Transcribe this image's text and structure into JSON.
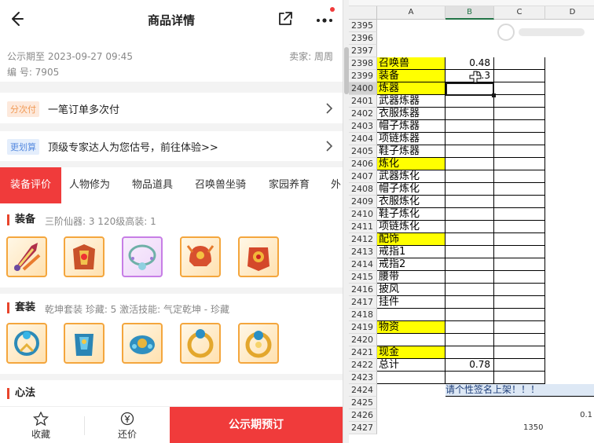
{
  "app": {
    "title": "商品详情",
    "announce_time": "公示期至 2023-09-27 09:45",
    "serial_label": "编 号: 7905",
    "seller_label": "卖家: 周周",
    "promos": [
      {
        "tag": "分次付",
        "text": "一笔订单多次付"
      },
      {
        "tag": "更划算",
        "text": "顶级专家达人为您估号，前往体验>>"
      }
    ],
    "tabs": [
      "装备评价",
      "人物修为",
      "物品道具",
      "召唤兽坐骑",
      "家园养育",
      "外"
    ],
    "equip": {
      "title": "装备",
      "sub": "三阶仙器: 3   120级高装: 1"
    },
    "suit": {
      "title": "套装",
      "sub": "乾坤套装  珍藏: 5  激活技能: 气定乾坤 - 珍藏"
    },
    "xinfa": {
      "title": "心法"
    },
    "bottom": {
      "fav": "收藏",
      "bargain": "还价",
      "buy": "公示期预订"
    },
    "colors": {
      "accent": "#f03b3b",
      "tag_orange": "#f19a55",
      "tag_blue": "#5b8de0"
    }
  },
  "sheet": {
    "columns": [
      "A",
      "B",
      "C",
      "D"
    ],
    "selected_column": "B",
    "selected_row": "2400",
    "rows": [
      {
        "n": "2395",
        "a": "",
        "b": "",
        "ay": false,
        "by": false
      },
      {
        "n": "2396",
        "a": "",
        "b": "",
        "ay": false,
        "by": false
      },
      {
        "n": "2397",
        "a": "",
        "b": "",
        "ay": false,
        "by": false
      },
      {
        "n": "2398",
        "a": "召唤兽",
        "b": "0.48",
        "ay": true,
        "by": true
      },
      {
        "n": "2399",
        "a": "装备",
        "b": "0.3",
        "ay": true,
        "by": true
      },
      {
        "n": "2400",
        "a": "炼器",
        "b": "",
        "ay": true,
        "by": false
      },
      {
        "n": "2401",
        "a": "武器炼器",
        "b": "",
        "ay": false,
        "by": false
      },
      {
        "n": "2402",
        "a": "衣服炼器",
        "b": "",
        "ay": false,
        "by": false
      },
      {
        "n": "2403",
        "a": "帽子炼器",
        "b": "",
        "ay": false,
        "by": false
      },
      {
        "n": "2404",
        "a": "项链炼器",
        "b": "",
        "ay": false,
        "by": false
      },
      {
        "n": "2405",
        "a": "鞋子炼器",
        "b": "",
        "ay": false,
        "by": false
      },
      {
        "n": "2406",
        "a": "炼化",
        "b": "",
        "ay": true,
        "by": false
      },
      {
        "n": "2407",
        "a": "武器炼化",
        "b": "",
        "ay": false,
        "by": false
      },
      {
        "n": "2408",
        "a": "帽子炼化",
        "b": "",
        "ay": false,
        "by": false
      },
      {
        "n": "2409",
        "a": "衣服炼化",
        "b": "",
        "ay": false,
        "by": false
      },
      {
        "n": "2410",
        "a": "鞋子炼化",
        "b": "",
        "ay": false,
        "by": false
      },
      {
        "n": "2411",
        "a": "项链炼化",
        "b": "",
        "ay": false,
        "by": false
      },
      {
        "n": "2412",
        "a": "配饰",
        "b": "",
        "ay": true,
        "by": false
      },
      {
        "n": "2413",
        "a": "戒指1",
        "b": "",
        "ay": false,
        "by": false
      },
      {
        "n": "2414",
        "a": "戒指2",
        "b": "",
        "ay": false,
        "by": false
      },
      {
        "n": "2415",
        "a": "腰带",
        "b": "",
        "ay": false,
        "by": false
      },
      {
        "n": "2416",
        "a": "披风",
        "b": "",
        "ay": false,
        "by": false
      },
      {
        "n": "2417",
        "a": "挂件",
        "b": "",
        "ay": false,
        "by": false
      },
      {
        "n": "2418",
        "a": "",
        "b": "",
        "ay": false,
        "by": false
      },
      {
        "n": "2419",
        "a": "物资",
        "b": "",
        "ay": true,
        "by": false
      },
      {
        "n": "2420",
        "a": "",
        "b": "",
        "ay": false,
        "by": false
      },
      {
        "n": "2421",
        "a": "现金",
        "b": "",
        "ay": true,
        "by": false
      },
      {
        "n": "2422",
        "a": "总计",
        "b": "0.78",
        "ay": false,
        "by": false
      },
      {
        "n": "2423",
        "a": "",
        "b": "",
        "ay": false,
        "by": false
      },
      {
        "n": "2424",
        "a": "",
        "b": "",
        "ay": false,
        "by": false
      },
      {
        "n": "2425",
        "a": "",
        "b": "",
        "ay": false,
        "by": false
      },
      {
        "n": "2426",
        "a": "",
        "b": "",
        "ay": false,
        "by": false
      },
      {
        "n": "2427",
        "a": "",
        "b": "",
        "ay": false,
        "by": false
      }
    ],
    "banner_text": "请个性签名上架！！！",
    "d2426": "0.1",
    "c2427": "1350",
    "colors": {
      "yellow": "#ffff00",
      "banner": "#dde8f5"
    }
  }
}
